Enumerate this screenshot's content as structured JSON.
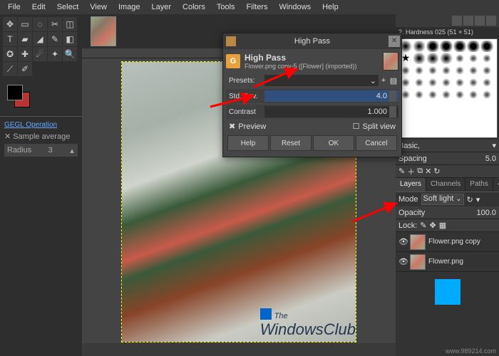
{
  "menu": [
    "File",
    "Edit",
    "Select",
    "View",
    "Image",
    "Layer",
    "Colors",
    "Tools",
    "Filters",
    "Windows",
    "Help"
  ],
  "toolbox": {
    "gegl_label": "GEGL Operation",
    "sample_close": "✕",
    "sample_label": "Sample average",
    "radius_label": "Radius",
    "radius_value": "3"
  },
  "brushes": {
    "header_label": "2. Hardness 025 (51 × 51)",
    "basic_label": "Basic,",
    "spacing_label": "Spacing",
    "spacing_value": "5.0"
  },
  "layers_panel": {
    "tabs": [
      "Layers",
      "Channels",
      "Paths"
    ],
    "mode_label": "Mode",
    "mode_value": "Soft light",
    "opacity_label": "Opacity",
    "opacity_value": "100.0",
    "lock_label": "Lock:",
    "layers": [
      {
        "name": "Flower.png copy"
      },
      {
        "name": "Flower.png"
      }
    ]
  },
  "dialog": {
    "title": "High Pass",
    "heading": "High Pass",
    "subtitle": "Flower.png copy-5 ([Flower] (imported))",
    "presets_label": "Presets:",
    "rows": [
      {
        "k": "Std. Dev.",
        "v": "4.0"
      },
      {
        "k": "Contrast",
        "v": "1.000"
      }
    ],
    "preview_label": "Preview",
    "split_label": "Split view",
    "buttons": [
      "Help",
      "Reset",
      "OK",
      "Cancel"
    ]
  },
  "watermark": {
    "l1": "The",
    "l2": "WindowsClub"
  },
  "footer_url": "www.989214.com"
}
